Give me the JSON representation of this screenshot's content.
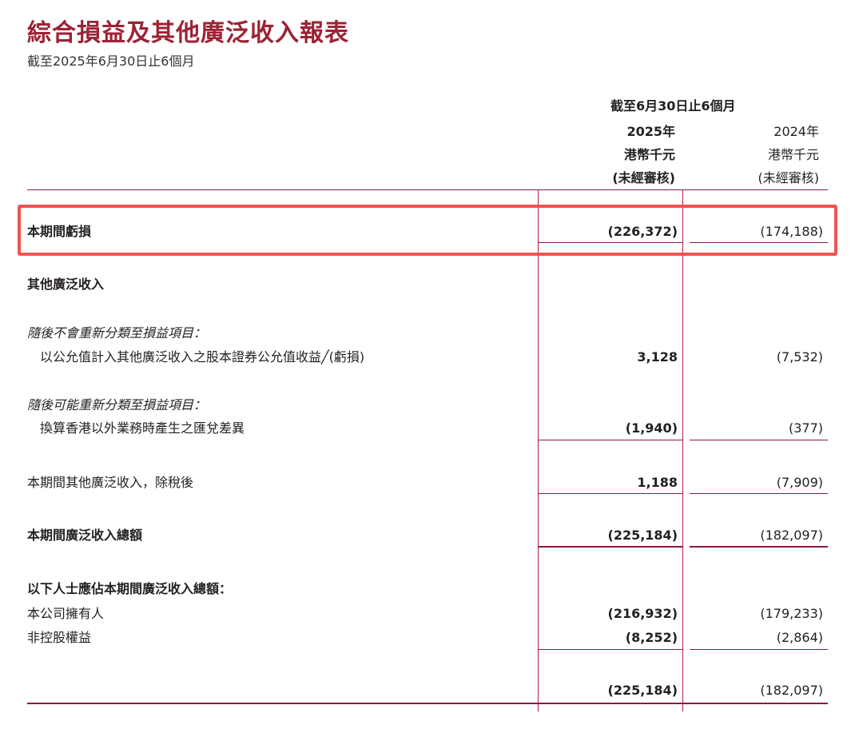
{
  "header": {
    "title": "綜合損益及其他廣泛收入報表",
    "subtitle": "截至2025年6月30日止6個月"
  },
  "columns": {
    "period_heading": "截至6月30日止6個月",
    "y2025": {
      "year": "2025年",
      "unit": "港幣千元",
      "audit": "(未經審核)"
    },
    "y2024": {
      "year": "2024年",
      "unit": "港幣千元",
      "audit": "(未經審核)"
    }
  },
  "rows": {
    "loss": {
      "label": "本期間虧損",
      "v2025": "(226,372)",
      "v2024": "(174,188)"
    },
    "oci_heading": {
      "label": "其他廣泛收入"
    },
    "not_reclass_heading": {
      "label": "隨後不會重新分類至損益項目："
    },
    "fvoci": {
      "label": "以公允值計入其他廣泛收入之股本證券公允值收益╱(虧損)",
      "v2025": "3,128",
      "v2024": "(7,532)"
    },
    "may_reclass_heading": {
      "label": "隨後可能重新分類至損益項目："
    },
    "fx": {
      "label": "換算香港以外業務時產生之匯兌差異",
      "v2025": "(1,940)",
      "v2024": "(377)"
    },
    "oci_net": {
      "label": "本期間其他廣泛收入，除稅後",
      "v2025": "1,188",
      "v2024": "(7,909)"
    },
    "total_ci": {
      "label": "本期間廣泛收入總額",
      "v2025": "(225,184)",
      "v2024": "(182,097)"
    },
    "attrib_heading": {
      "label": "以下人士應佔本期間廣泛收入總額："
    },
    "owners": {
      "label": "本公司擁有人",
      "v2025": "(216,932)",
      "v2024": "(179,233)"
    },
    "nci": {
      "label": "非控股權益",
      "v2025": "(8,252)",
      "v2024": "(2,864)"
    },
    "final_total": {
      "v2025": "(225,184)",
      "v2024": "(182,097)"
    }
  },
  "colors": {
    "title": "#9b2335",
    "rule": "#8b1c3a",
    "column_box": "#b5175f",
    "highlight": "#ef5353"
  }
}
